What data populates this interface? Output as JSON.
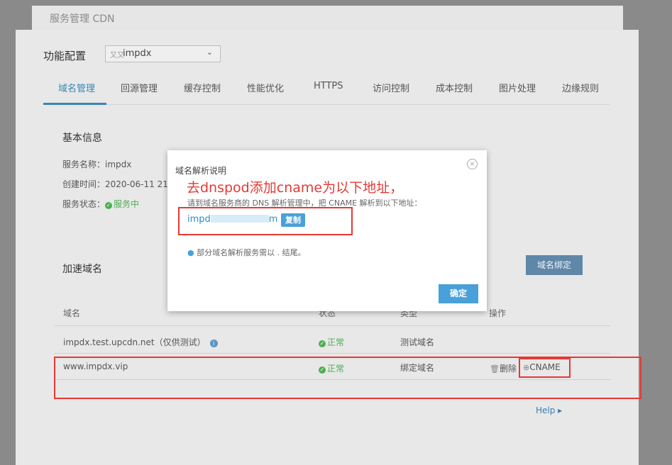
{
  "header": {
    "title": "服务管理 CDN"
  },
  "config": {
    "label": "功能配置",
    "service_icon": "又又",
    "service_value": "impdx",
    "caret": "⌄"
  },
  "tabs": [
    {
      "label": "域名管理"
    },
    {
      "label": "回源管理"
    },
    {
      "label": "缓存控制"
    },
    {
      "label": "性能优化"
    },
    {
      "label": "HTTPS"
    },
    {
      "label": "访问控制"
    },
    {
      "label": "成本控制"
    },
    {
      "label": "图片处理"
    },
    {
      "label": "边缘规则"
    }
  ],
  "basic_info": {
    "title": "基本信息",
    "service_name_label": "服务名称：",
    "service_name": "impdx",
    "created_label": "创建时间：",
    "created_value": "2020-06-11 21:1",
    "status_label": "服务状态：",
    "status_value": "服务中"
  },
  "accel": {
    "title": "加速域名",
    "bind_button": "域名绑定",
    "columns": {
      "domain": "域名",
      "state": "状态",
      "type": "类型",
      "actions": "操作"
    },
    "rows": [
      {
        "domain": "impdx.test.upcdn.net（仅供测试）",
        "state": "正常",
        "type": "测试域名"
      },
      {
        "domain": "www.impdx.vip",
        "state": "正常",
        "type": "绑定域名",
        "delete": "删除",
        "cname": "CNAME"
      }
    ],
    "help": "Help ▸"
  },
  "modal": {
    "title": "域名解析说明",
    "annotation": "去dnspod添加cname为以下地址，",
    "instruction": "请到域名服务商的 DNS 解析管理中，把 CNAME 解析到以下地址：",
    "address_start": "impd",
    "address_end": "m",
    "copy_button": "复制",
    "tip": "部分域名解析服务需以 . 结尾。",
    "ok_button": "确定",
    "close": "×"
  }
}
